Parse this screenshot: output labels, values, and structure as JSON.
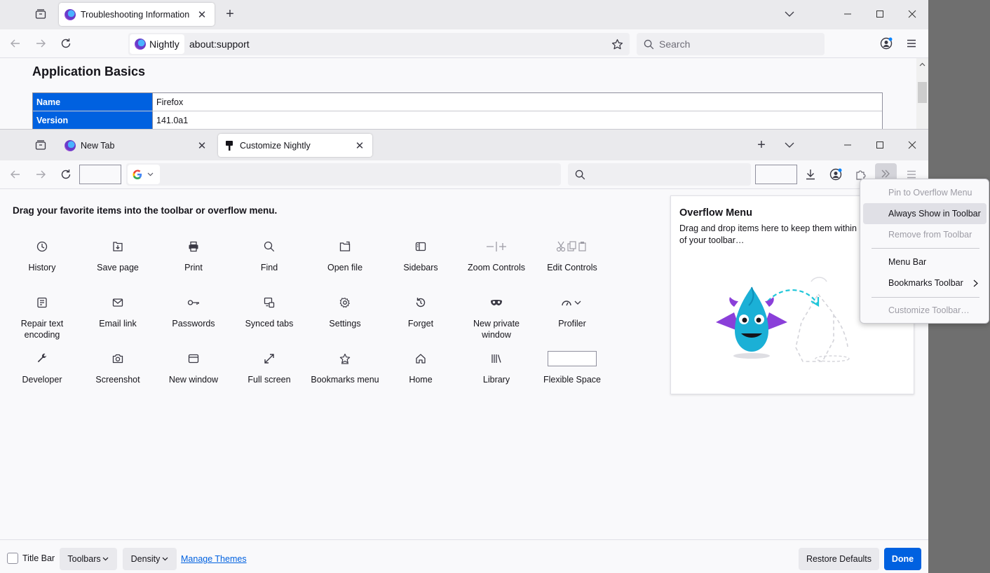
{
  "back_window": {
    "tab": {
      "title": "Troubleshooting Information",
      "close": "✕"
    },
    "new_tab_icon": "+",
    "identity_label": "Nightly",
    "url": "about:support",
    "search_placeholder": "Search",
    "page_title": "Application Basics",
    "table": [
      {
        "key": "Name",
        "value": "Firefox"
      },
      {
        "key": "Version",
        "value": "141.0a1"
      }
    ]
  },
  "front_window": {
    "tabs": [
      {
        "title": "New Tab",
        "close": "✕"
      },
      {
        "title": "Customize Nightly",
        "close": "✕"
      }
    ],
    "new_tab_icon": "+",
    "heading": "Drag your favorite items into the toolbar or overflow menu.",
    "palette": [
      {
        "label": "History",
        "icon": "clock-icon"
      },
      {
        "label": "Save page",
        "icon": "save-page-icon"
      },
      {
        "label": "Print",
        "icon": "printer-icon"
      },
      {
        "label": "Find",
        "icon": "magnifier-icon"
      },
      {
        "label": "Open file",
        "icon": "open-file-icon"
      },
      {
        "label": "Sidebars",
        "icon": "sidebar-icon"
      },
      {
        "label": "Zoom Controls",
        "icon": "zoom-controls-icon"
      },
      {
        "label": "Edit Controls",
        "icon": "edit-controls-icon"
      },
      {
        "label": "Repair text encoding",
        "icon": "text-encoding-icon"
      },
      {
        "label": "Email link",
        "icon": "envelope-icon"
      },
      {
        "label": "Passwords",
        "icon": "key-icon"
      },
      {
        "label": "Synced tabs",
        "icon": "synced-tabs-icon"
      },
      {
        "label": "Settings",
        "icon": "gear-icon"
      },
      {
        "label": "Forget",
        "icon": "forget-icon"
      },
      {
        "label": "New private window",
        "icon": "mask-icon"
      },
      {
        "label": "Profiler",
        "icon": "profiler-icon"
      },
      {
        "label": "Developer",
        "icon": "wrench-icon"
      },
      {
        "label": "Screenshot",
        "icon": "camera-icon"
      },
      {
        "label": "New window",
        "icon": "window-icon"
      },
      {
        "label": "Full screen",
        "icon": "fullscreen-icon"
      },
      {
        "label": "Bookmarks menu",
        "icon": "bookmark-star-icon"
      },
      {
        "label": "Home",
        "icon": "home-icon"
      },
      {
        "label": "Library",
        "icon": "library-icon"
      },
      {
        "label": "Flexible Space",
        "icon": "flexible-space-box"
      }
    ],
    "overflow_panel": {
      "title": "Overflow Menu",
      "text": "Drag and drop items here to keep them within reach but out of your toolbar…"
    },
    "footer": {
      "title_bar_label": "Title Bar",
      "toolbars_label": "Toolbars",
      "density_label": "Density",
      "manage_themes_label": "Manage Themes",
      "restore_defaults_label": "Restore Defaults",
      "done_label": "Done"
    }
  },
  "context_menu": {
    "items": [
      {
        "label": "Pin to Overflow Menu",
        "state": "disabled"
      },
      {
        "label": "Always Show in Toolbar",
        "state": "highlighted"
      },
      {
        "label": "Remove from Toolbar",
        "state": "disabled"
      },
      {
        "label": "Menu Bar",
        "state": "enabled"
      },
      {
        "label": "Bookmarks Toolbar",
        "state": "enabled",
        "submenu": true
      },
      {
        "label": "Customize Toolbar…",
        "state": "disabled"
      }
    ]
  },
  "colors": {
    "accent": "#0061e0",
    "table_key_bg": "#0061e0",
    "dragon_blue": "#1bb0d6",
    "dragon_purple": "#8a3fd9"
  }
}
